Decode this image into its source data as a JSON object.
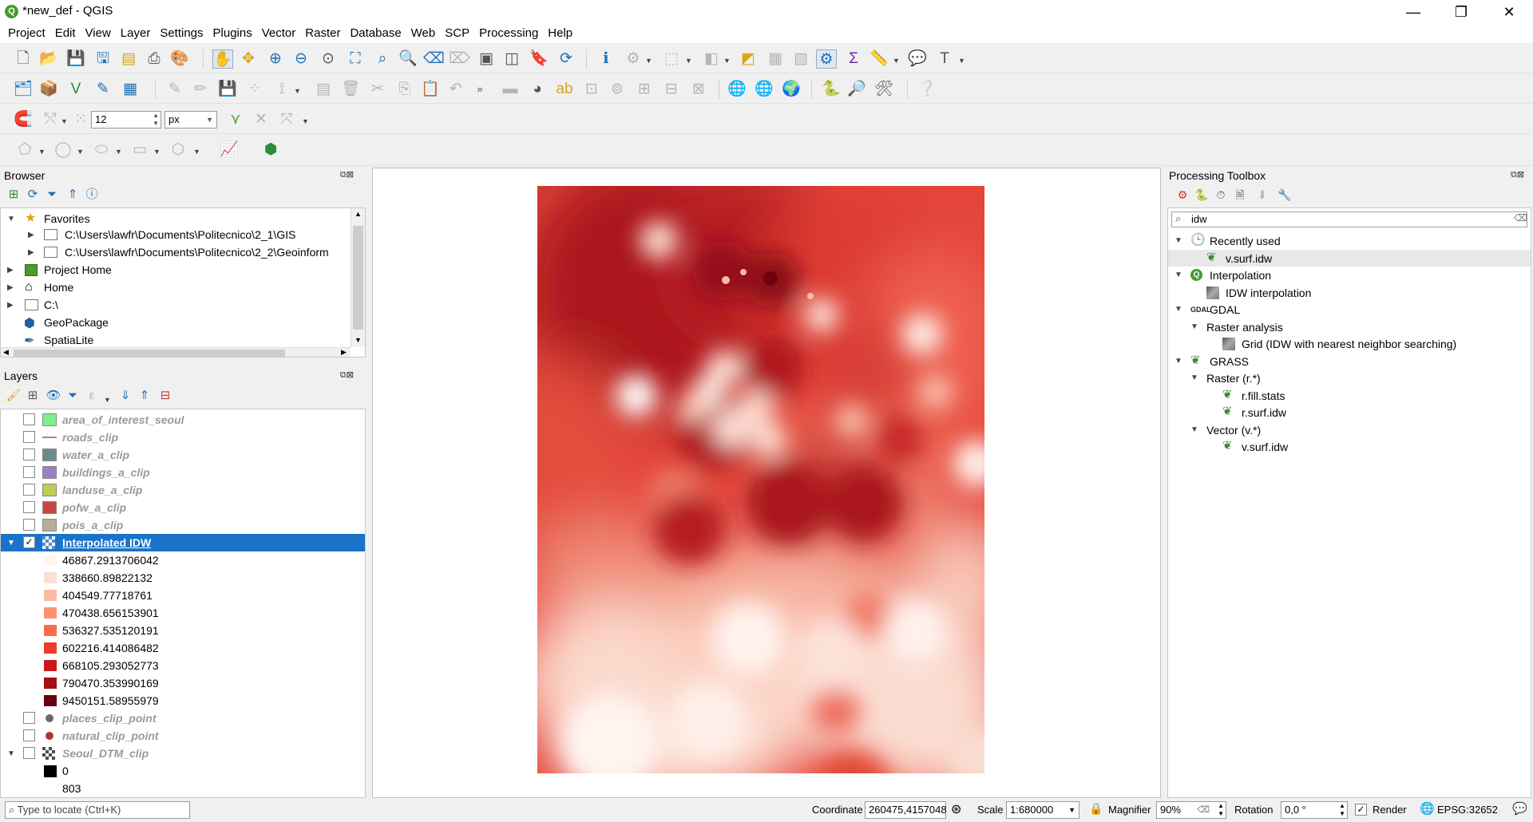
{
  "window": {
    "title": "*new_def - QGIS",
    "min": "—",
    "max": "❐",
    "close": "✕"
  },
  "menu": [
    "Project",
    "Edit",
    "View",
    "Layer",
    "Settings",
    "Plugins",
    "Vector",
    "Raster",
    "Database",
    "Web",
    "SCP",
    "Processing",
    "Help"
  ],
  "snap": {
    "tolerance": "12",
    "unit": "px"
  },
  "browser": {
    "title": "Browser",
    "items": [
      {
        "label": "Favorites",
        "icon": "star-icon"
      },
      {
        "label": "C:\\Users\\lawfr\\Documents\\Politecnico\\2_1\\GIS",
        "icon": "folder-icon"
      },
      {
        "label": "C:\\Users\\lawfr\\Documents\\Politecnico\\2_2\\Geoinform",
        "icon": "folder-icon"
      },
      {
        "label": "Project Home",
        "icon": "project-home-icon"
      },
      {
        "label": "Home",
        "icon": "home-icon"
      },
      {
        "label": "C:\\",
        "icon": "drive-icon"
      },
      {
        "label": "GeoPackage",
        "icon": "geopackage-icon"
      },
      {
        "label": "SpatiaLite",
        "icon": "spatialite-icon"
      }
    ]
  },
  "layers": {
    "title": "Layers",
    "items": [
      {
        "label": "area_of_interest_seoul",
        "color": "#7ef08a",
        "kind": "fill"
      },
      {
        "label": "roads_clip",
        "color": "#c77a7a",
        "kind": "line"
      },
      {
        "label": "water_a_clip",
        "color": "#6f8a8a",
        "kind": "fill"
      },
      {
        "label": "buildings_a_clip",
        "color": "#9b7fc8",
        "kind": "fill"
      },
      {
        "label": "landuse_a_clip",
        "color": "#c0cc55",
        "kind": "fill"
      },
      {
        "label": "pofw_a_clip",
        "color": "#c94545",
        "kind": "fill"
      },
      {
        "label": "pois_a_clip",
        "color": "#b8ae94",
        "kind": "fill"
      }
    ],
    "idw": {
      "label": "Interpolated IDW",
      "classes": [
        {
          "value": "46867.2913706042",
          "color": "#fff5f0"
        },
        {
          "value": "338660.89822132",
          "color": "#fde0d2"
        },
        {
          "value": "404549.77718761",
          "color": "#fcbba1"
        },
        {
          "value": "470438.656153901",
          "color": "#fc9272"
        },
        {
          "value": "536327.535120191",
          "color": "#fb6a4a"
        },
        {
          "value": "602216.414086482",
          "color": "#ef3b2c"
        },
        {
          "value": "668105.293052773",
          "color": "#cb181d"
        },
        {
          "value": "790470.353990169",
          "color": "#a50f15"
        },
        {
          "value": "9450151.58955979",
          "color": "#67000d"
        }
      ]
    },
    "points": [
      {
        "label": "places_clip_point",
        "color": "#6a6a6a"
      },
      {
        "label": "natural_clip_point",
        "color": "#b23232"
      }
    ],
    "dtm": {
      "label": "Seoul_DTM_clip",
      "min": "0",
      "max": "803"
    }
  },
  "toolbox": {
    "title": "Processing Toolbox",
    "search": "idw",
    "tree": [
      {
        "label": "Recently used",
        "level": 0,
        "icon": "clock-icon"
      },
      {
        "label": "v.surf.idw",
        "level": 1,
        "icon": "grass-icon"
      },
      {
        "label": "Interpolation",
        "level": 0,
        "icon": "qgis-icon"
      },
      {
        "label": "IDW interpolation",
        "level": 1,
        "icon": "raster-icon"
      },
      {
        "label": "GDAL",
        "level": 0,
        "icon": "gdal-icon"
      },
      {
        "label": "Raster analysis",
        "level": 1,
        "icon": ""
      },
      {
        "label": "Grid (IDW with nearest neighbor searching)",
        "level": 2,
        "icon": "raster-icon"
      },
      {
        "label": "GRASS",
        "level": 0,
        "icon": "grass-icon"
      },
      {
        "label": "Raster (r.*)",
        "level": 1,
        "icon": ""
      },
      {
        "label": "r.fill.stats",
        "level": 2,
        "icon": "grass-icon"
      },
      {
        "label": "r.surf.idw",
        "level": 2,
        "icon": "grass-icon"
      },
      {
        "label": "Vector (v.*)",
        "level": 1,
        "icon": ""
      },
      {
        "label": "v.surf.idw",
        "level": 2,
        "icon": "grass-icon"
      }
    ]
  },
  "status": {
    "locate_placeholder": "Type to locate (Ctrl+K)",
    "coordinate_label": "Coordinate",
    "coordinate": "260475,4157048",
    "scale_label": "Scale",
    "scale": "1:680000",
    "magnifier_label": "Magnifier",
    "magnifier": "90%",
    "rotation_label": "Rotation",
    "rotation": "0,0 °",
    "render_label": "Render",
    "crs": "EPSG:32652"
  }
}
